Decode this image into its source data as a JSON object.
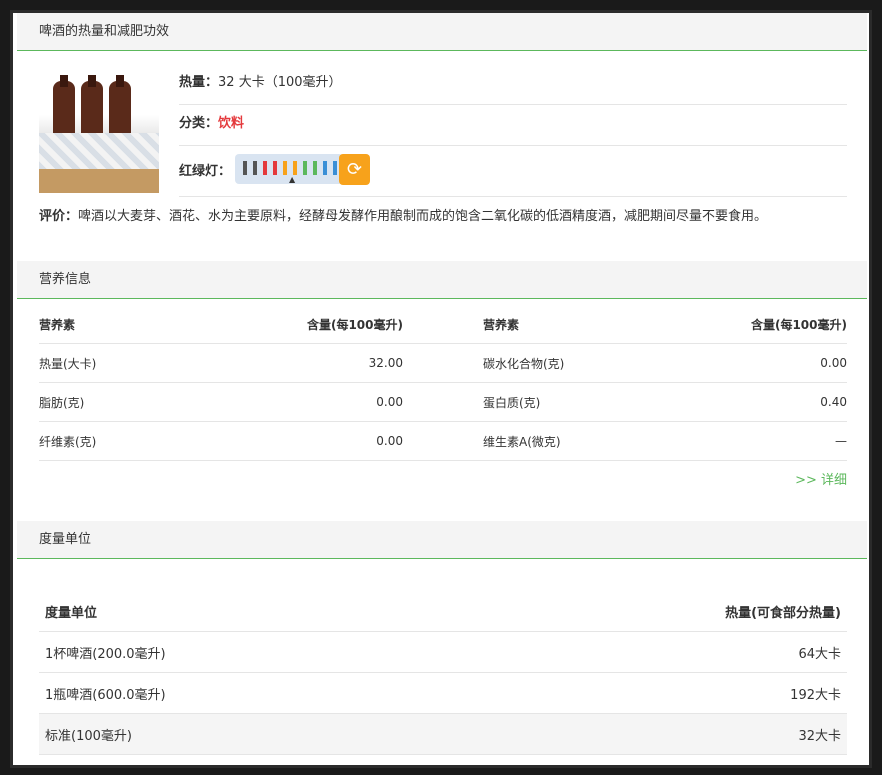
{
  "header": {
    "title": "啤酒的热量和减肥功效"
  },
  "food": {
    "calorie_label": "热量：",
    "calorie_value": "32 大卡（100毫升）",
    "category_label": "分类：",
    "category_value": "饮料",
    "light_label": "红绿灯：",
    "comment_label": "评价：",
    "comment_text": "啤酒以大麦芽、酒花、水为主要原料，经酵母发酵作用酿制而成的饱含二氧化碳的低酒精度酒，减肥期间尽量不要食用。"
  },
  "light_colors": [
    "#555555",
    "#555555",
    "#e4393c",
    "#e4393c",
    "#f7a21b",
    "#f7a21b",
    "#5cb85c",
    "#5cb85c",
    "#3a8fd6",
    "#3a8fd6"
  ],
  "nutrition": {
    "title": "营养信息",
    "headers": {
      "name": "营养素",
      "value": "含量(每100毫升)"
    },
    "rows": [
      {
        "left_name": "热量(大卡)",
        "left_value": "32.00",
        "right_name": "碳水化合物(克)",
        "right_value": "0.00"
      },
      {
        "left_name": "脂肪(克)",
        "left_value": "0.00",
        "right_name": "蛋白质(克)",
        "right_value": "0.40"
      },
      {
        "left_name": "纤维素(克)",
        "left_value": "0.00",
        "right_name": "维生素A(微克)",
        "right_value": "—"
      }
    ],
    "detail_link": ">> 详细"
  },
  "units": {
    "title": "度量单位",
    "headers": {
      "unit": "度量单位",
      "calorie": "热量(可食部分热量)"
    },
    "rows": [
      {
        "unit": "1杯啤酒(200.0毫升)",
        "calorie": "64大卡"
      },
      {
        "unit": "1瓶啤酒(600.0毫升)",
        "calorie": "192大卡"
      },
      {
        "unit": "标准(100毫升)",
        "calorie": "32大卡"
      }
    ]
  }
}
